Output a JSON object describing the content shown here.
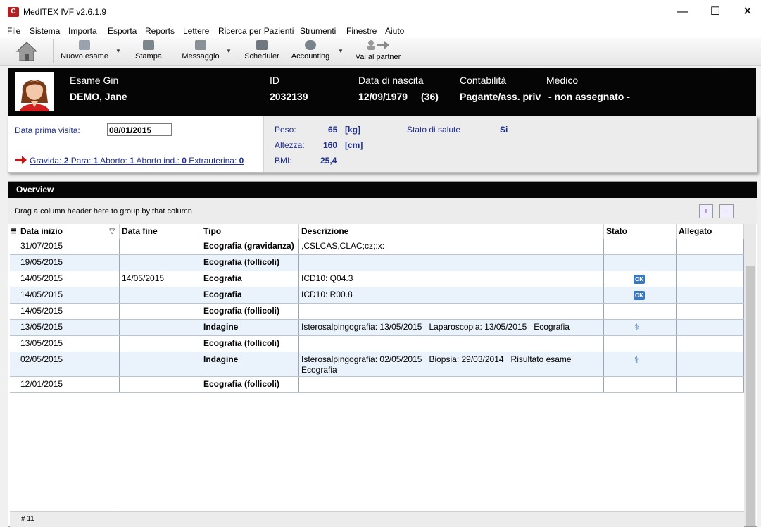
{
  "window": {
    "title": "MedITEX IVF v2.6.1.9",
    "controls": [
      "—",
      "☐",
      "✕"
    ]
  },
  "menu": [
    "File",
    "Sistema",
    "Importa",
    "Esporta",
    "Reports",
    "Lettere",
    "Ricerca per Pazienti",
    "Strumenti",
    "Finestre",
    "Aiuto"
  ],
  "toolbar": {
    "home_icon": "home-icon",
    "buttons": [
      {
        "label": "Nuovo esame",
        "icon": "new-exam-icon"
      },
      {
        "label": "Stampa",
        "icon": "printer-icon"
      },
      {
        "label": "Messaggio",
        "icon": "message-icon"
      },
      {
        "label": "Scheduler",
        "icon": "calendar-icon"
      },
      {
        "label": "Accounting",
        "icon": "money-bag-icon"
      },
      {
        "label": "Vai al partner",
        "icon": "partner-arrow-icon"
      }
    ]
  },
  "patient": {
    "labels": {
      "exam": "Esame Gin",
      "id": "ID",
      "dob": "Data di nascita",
      "account": "Contabilità",
      "doctor": "Medico"
    },
    "name": "DEMO, Jane",
    "id": "2032139",
    "dob": "12/09/1979",
    "age": "(36)",
    "account": "Pagante/ass. priv",
    "doctor": "- non assegnato -"
  },
  "details": {
    "first_visit_label": "Data prima visita:",
    "first_visit": "08/01/2015",
    "obstetric": {
      "gravida_label": "Gravida:",
      "gravida": "2",
      "para_label": "Para:",
      "para": "1",
      "aborto_label": "Aborto:",
      "aborto": "1",
      "aborto_ind_label": "Aborto ind.:",
      "aborto_ind": "0",
      "extra_label": "Extrauterina:",
      "extra": "0"
    },
    "weight_label": "Peso:",
    "weight": "65",
    "weight_unit": "[kg]",
    "height_label": "Altezza:",
    "height": "160",
    "height_unit": "[cm]",
    "bmi_label": "BMI:",
    "bmi": "25,4",
    "health_label": "Stato di salute",
    "health": "Si"
  },
  "overview": {
    "title": "Overview",
    "group_hint": "Drag a column header here to group by that column",
    "expand": "+",
    "collapse": "−",
    "columns": [
      "Data inizio",
      "Data fine",
      "Tipo",
      "Descrizione",
      "Stato",
      "Allegato"
    ],
    "sort_glyph": "▽",
    "rows": [
      {
        "start": "31/07/2015",
        "end": "",
        "type": "Ecografia (gravidanza)",
        "desc": ",CSLCAS,CLAC;cz;:x:",
        "status": ""
      },
      {
        "start": "19/05/2015",
        "end": "",
        "type": "Ecografia (follicoli)",
        "desc": "",
        "status": ""
      },
      {
        "start": "14/05/2015",
        "end": "14/05/2015",
        "type": "Ecografia",
        "desc": "ICD10: Q04.3",
        "status": "OK"
      },
      {
        "start": "14/05/2015",
        "end": "",
        "type": "Ecografia",
        "desc": "ICD10: R00.8",
        "status": "OK"
      },
      {
        "start": "14/05/2015",
        "end": "",
        "type": "Ecografia (follicoli)",
        "desc": "",
        "status": ""
      },
      {
        "start": "13/05/2015",
        "end": "",
        "type": "Indagine",
        "desc": "Isterosalpingografia: 13/05/2015   Laparoscopia: 13/05/2015   Ecografia",
        "status": "doc-stethoscope-icon"
      },
      {
        "start": "13/05/2015",
        "end": "",
        "type": "Ecografia (follicoli)",
        "desc": "",
        "status": ""
      },
      {
        "start": "02/05/2015",
        "end": "",
        "type": "Indagine",
        "desc": "Isterosalpingografia: 02/05/2015   Biopsia: 29/03/2014   Risultato esame Ecografia",
        "status": "stethoscope-icon"
      },
      {
        "start": "12/01/2015",
        "end": "",
        "type": "Ecografia (follicoli)",
        "desc": "",
        "status": ""
      }
    ],
    "footer_count": "# 11"
  }
}
